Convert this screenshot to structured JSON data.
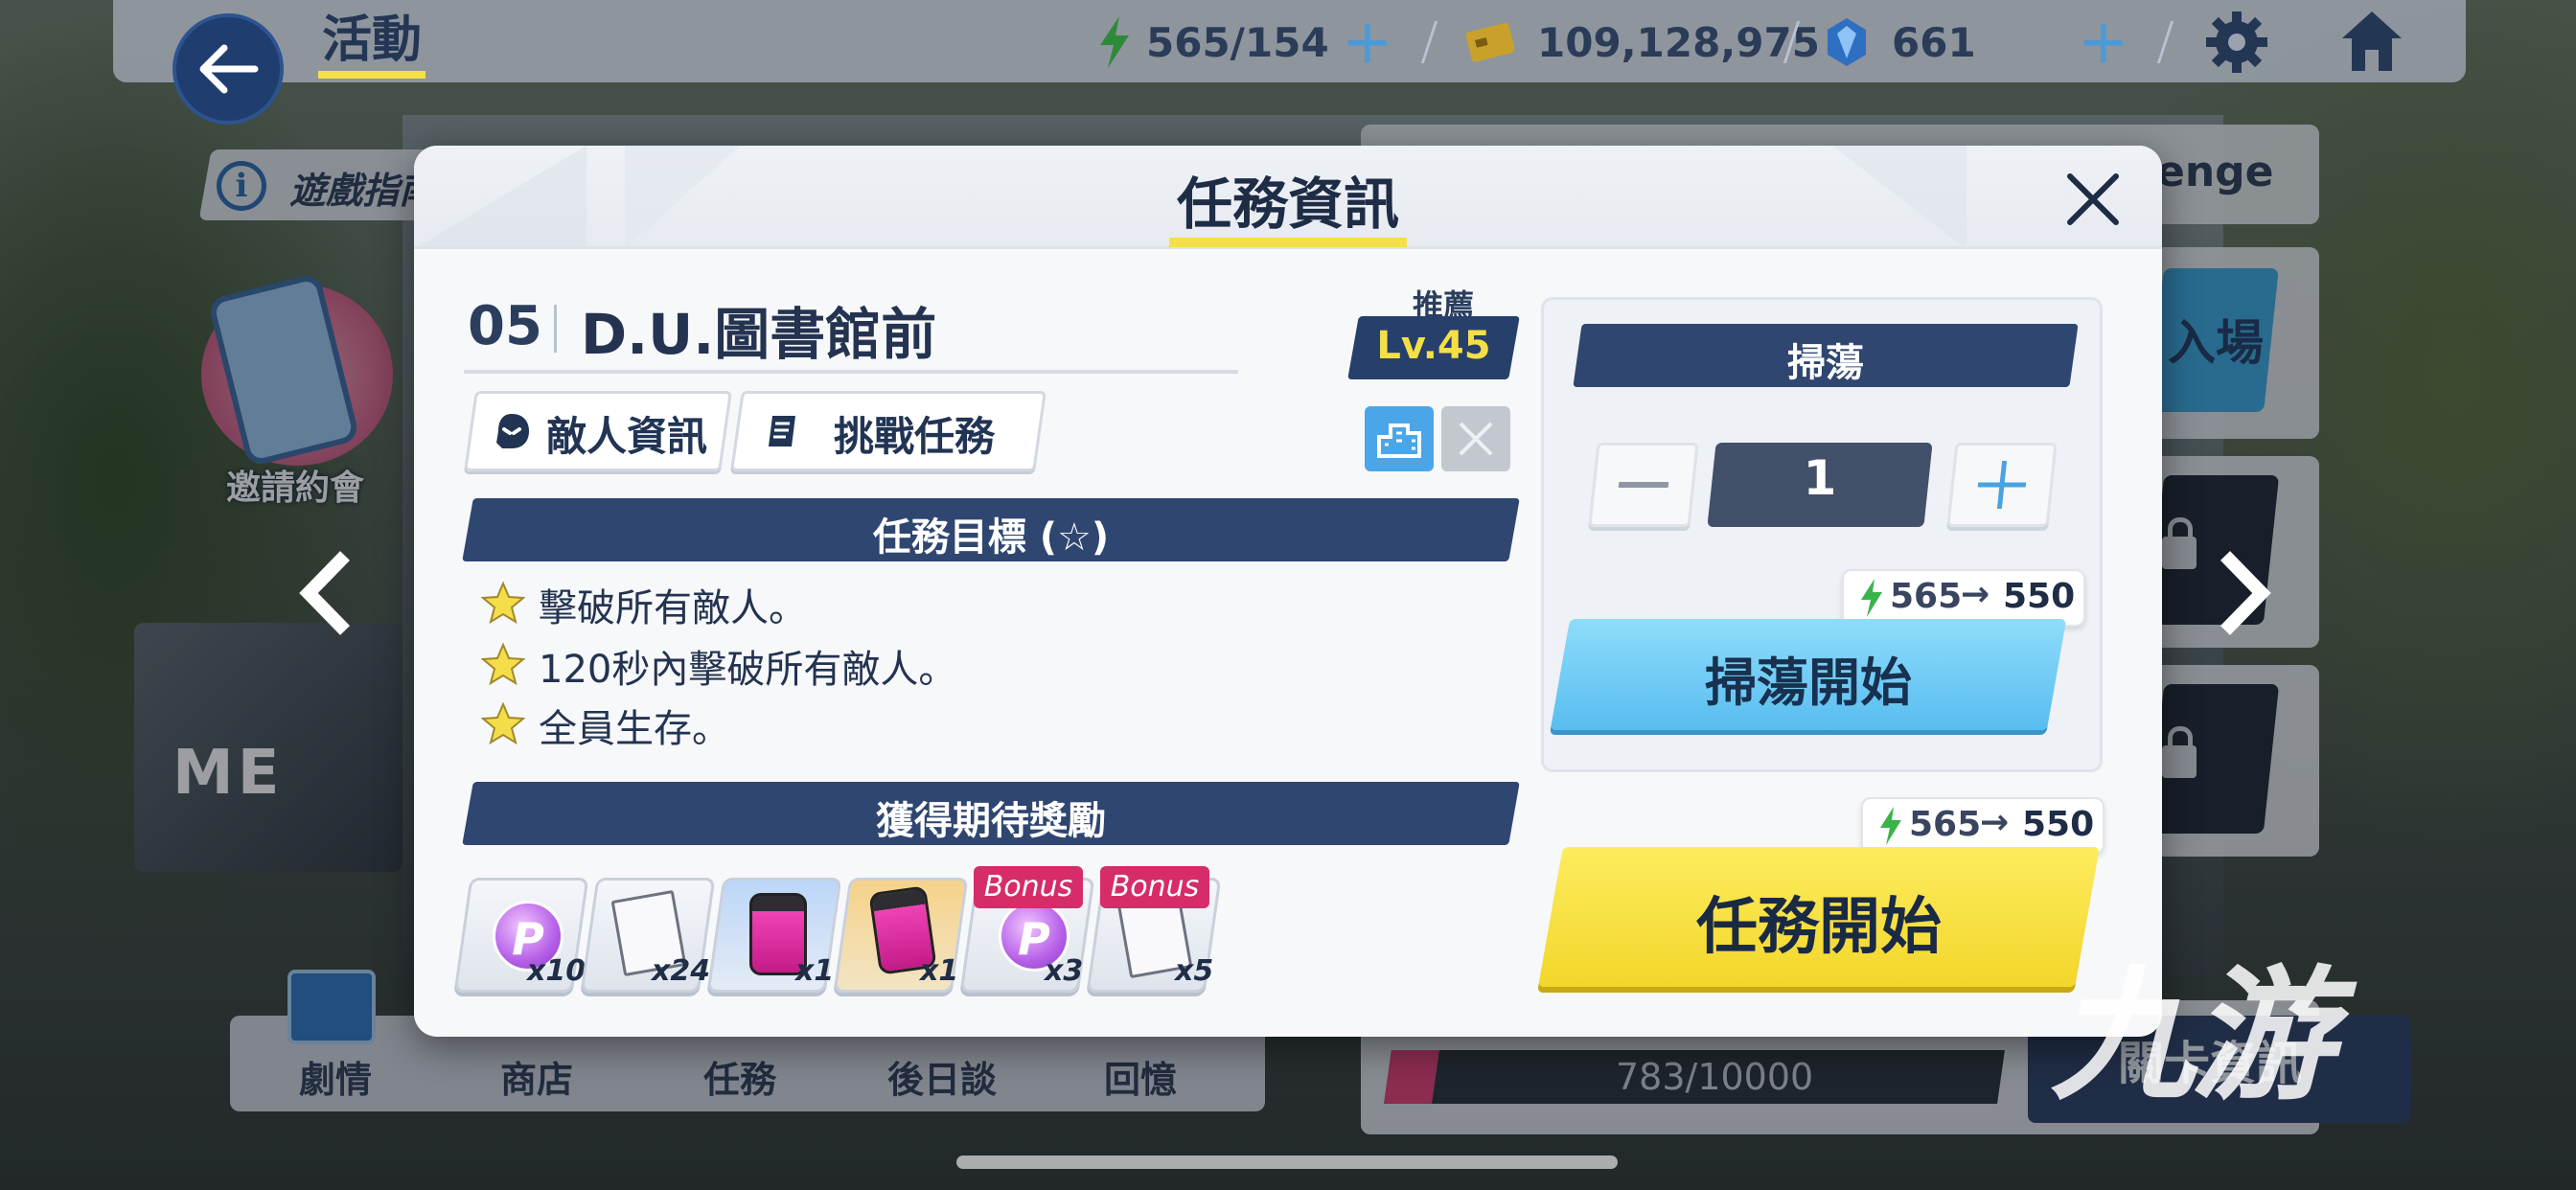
{
  "topbar": {
    "title": "活動",
    "ap": "565/154",
    "credits": "109,128,975",
    "gems": "661"
  },
  "background": {
    "guide_label": "遊戲指南",
    "invite_label": "邀請約會",
    "challenge_label": "enge",
    "enter_label": "入場",
    "event_ad_text": "ME",
    "progress_text": "783/10000",
    "progress_fraction": 0.0783,
    "mission_info_label": "關卡資訊",
    "watermark": "九游",
    "bottom_nav": [
      {
        "label": "劇情"
      },
      {
        "label": "商店"
      },
      {
        "label": "任務"
      },
      {
        "label": "後日談"
      },
      {
        "label": "回憶"
      }
    ]
  },
  "modal": {
    "title": "任務資訊",
    "stage": {
      "number": "05",
      "name": "D.U.圖書館前"
    },
    "recommend_label": "推薦",
    "level": "Lv.45",
    "tabs": [
      {
        "label": "敵人資訊",
        "icon": "enemy-icon"
      },
      {
        "label": "挑戰任務",
        "icon": "document-icon"
      }
    ],
    "objectives_title": "任務目標 (☆)",
    "objectives": [
      "擊破所有敵人。",
      "120秒內擊破所有敵人。",
      "全員生存。"
    ],
    "rewards_title": "獲得期待獎勵",
    "rewards": [
      {
        "icon": "pyroxene-coin-icon",
        "qty": "x10",
        "bonus": ""
      },
      {
        "icon": "report-paper-icon",
        "qty": "x24",
        "bonus": ""
      },
      {
        "icon": "pink-canister-icon",
        "qty": "x1",
        "bonus": ""
      },
      {
        "icon": "pink-canister-icon",
        "qty": "x1",
        "bonus": ""
      },
      {
        "icon": "pyroxene-coin-icon",
        "qty": "x3",
        "bonus": "Bonus"
      },
      {
        "icon": "report-paper-icon",
        "qty": "x5",
        "bonus": "Bonus"
      }
    ],
    "sweep": {
      "title": "掃蕩",
      "count": "1",
      "ap_from": "565",
      "ap_to": "550",
      "start_label": "掃蕩開始"
    },
    "mission": {
      "ap_from": "565",
      "ap_to": "550",
      "start_label": "任務開始"
    }
  },
  "colors": {
    "accent_yellow": "#f5df47",
    "navy": "#2f4670",
    "sweep_blue": "#58bdf0",
    "bonus_pink": "#d62c6a"
  }
}
